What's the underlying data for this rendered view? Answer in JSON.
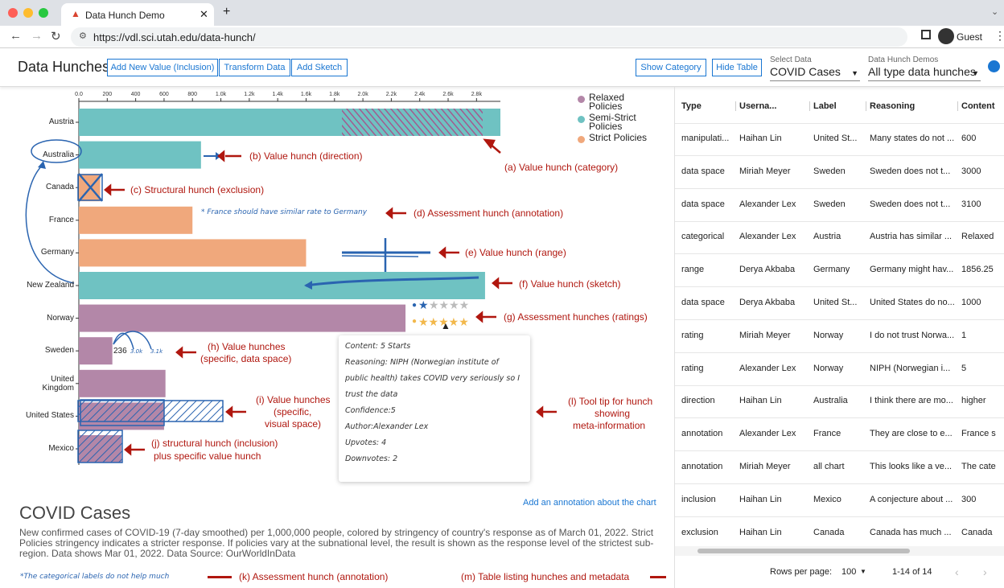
{
  "browser": {
    "tab_title": "Data Hunch Demo",
    "url": "https://vdl.sci.utah.edu/data-hunch/",
    "profile": "Guest"
  },
  "app": {
    "title": "Data Hunches",
    "toolbar": {
      "add_new_value": "Add New Value (Inclusion)",
      "transform_data": "Transform Data",
      "add_sketch": "Add Sketch",
      "show_category": "Show Category",
      "hide_table": "Hide Table"
    },
    "select_data": {
      "label": "Select Data",
      "value": "COVID Cases"
    },
    "demos": {
      "label": "Data Hunch Demos",
      "value": "All type data hunches"
    }
  },
  "chart_data": {
    "type": "bar",
    "orientation": "horizontal",
    "categories": [
      "Austria",
      "Australia",
      "Canada",
      "France",
      "Germany",
      "New Zealand",
      "Norway",
      "Sweden",
      "United Kingdom",
      "United States",
      "Mexico"
    ],
    "values": [
      2968,
      860,
      150,
      800,
      1600,
      2860,
      2300,
      236,
      610,
      600,
      300
    ],
    "group": [
      "Semi-Strict Policies",
      "Semi-Strict Policies",
      "Strict Policies",
      "Strict Policies",
      "Strict Policies",
      "Semi-Strict Policies",
      "Relaxed Policies",
      "Relaxed Policies",
      "Relaxed Policies",
      "Relaxed Policies",
      "Relaxed Policies"
    ],
    "x_ticks": [
      "0.0",
      "200",
      "400",
      "600",
      "800",
      "1.0k",
      "1.2k",
      "1.4k",
      "1.6k",
      "1.8k",
      "2.0k",
      "2.2k",
      "2.4k",
      "2.6k",
      "2.8k"
    ],
    "xlim": [
      0,
      2968
    ],
    "legend": [
      {
        "name": "Relaxed Policies",
        "color": "#b387a8"
      },
      {
        "name": "Semi-Strict Policies",
        "color": "#6fc2c2"
      },
      {
        "name": "Strict Policies",
        "color": "#f0a87c"
      }
    ],
    "legend_position": "top-right",
    "annotations": {
      "a": "(a) Value hunch (category)",
      "b": "(b) Value hunch (direction)",
      "c": "(c) Structural hunch (exclusion)",
      "d": "(d) Assessment hunch (annotation)",
      "e": "(e) Value hunch (range)",
      "f": "(f) Value hunch (sketch)",
      "g": "(g) Assessment hunches (ratings)",
      "h1": "(h) Value hunches",
      "h2": "(specific, data space)",
      "i1": "(i) Value hunches",
      "i2": "(specific,",
      "i3": "visual space)",
      "j1": "(j) structural hunch (inclusion)",
      "j2": "plus specific value hunch",
      "l1": "(l) Tool tip for hunch",
      "l2": "showing",
      "l3": "meta-information",
      "k": "(k) Assessment hunch (annotation)",
      "m": "(m) Table listing hunches and metadata"
    },
    "france_note": "* France should have similar rate to Germany",
    "sweden_values": [
      "236",
      "3.0k",
      "3.1k"
    ]
  },
  "tooltip": {
    "content": "Content: 5 Starts",
    "reasoning1": "Reasoning: NIPH (Norwegian institute of",
    "reasoning2": "public health) takes COVID very seriously so I",
    "reasoning3": "trust the data",
    "confidence": "Confidence:5",
    "author": "Author:Alexander Lex",
    "upvotes": "Upvotes: 4",
    "downvotes": "Downvotes: 2"
  },
  "chart_annotation_link": "Add an annotation about the chart",
  "description": {
    "title": "COVID Cases",
    "body": "New confirmed cases of COVID-19 (7-day smoothed) per 1,000,000 people, colored by stringency of country's response as of March 01, 2022. Strict Policies stringency indicates a stricter response. If policies vary at the subnational level, the result is shown as the response level of the strictest sub-region. Data shows Mar 01, 2022. Data Source: OurWorldInData",
    "handwritten_note": "*The categorical labels do not help much"
  },
  "table": {
    "headers": [
      "Type",
      "Userna...",
      "Label",
      "Reasoning",
      "Content"
    ],
    "rows": [
      [
        "manipulati...",
        "Haihan Lin",
        "United St...",
        "Many states do not ...",
        "600"
      ],
      [
        "data space",
        "Miriah Meyer",
        "Sweden",
        "Sweden does not t...",
        "3000"
      ],
      [
        "data space",
        "Alexander Lex",
        "Sweden",
        "Sweden does not t...",
        "3100"
      ],
      [
        "categorical",
        "Alexander Lex",
        "Austria",
        "Austria has similar ...",
        "Relaxed"
      ],
      [
        "range",
        "Derya Akbaba",
        "Germany",
        "Germany might hav...",
        "1856.25"
      ],
      [
        "data space",
        "Derya Akbaba",
        "United St...",
        "United States do no...",
        "1000"
      ],
      [
        "rating",
        "Miriah Meyer",
        "Norway",
        "I do not trust Norwa...",
        "1"
      ],
      [
        "rating",
        "Alexander Lex",
        "Norway",
        "NIPH (Norwegian i...",
        "5"
      ],
      [
        "direction",
        "Haihan Lin",
        "Australia",
        "I think there are mo...",
        "higher"
      ],
      [
        "annotation",
        "Alexander Lex",
        "France",
        "They are close to e...",
        "France s"
      ],
      [
        "annotation",
        "Miriah Meyer",
        "all chart",
        "This looks like a ve...",
        "The cate"
      ],
      [
        "inclusion",
        "Haihan Lin",
        "Mexico",
        "A conjecture about ...",
        "300"
      ],
      [
        "exclusion",
        "Haihan Lin",
        "Canada",
        "Canada has much ...",
        "Canada"
      ]
    ],
    "pagination": {
      "rows_per_page_label": "Rows per page:",
      "rows_per_page": "100",
      "range": "1-14 of 14"
    }
  }
}
